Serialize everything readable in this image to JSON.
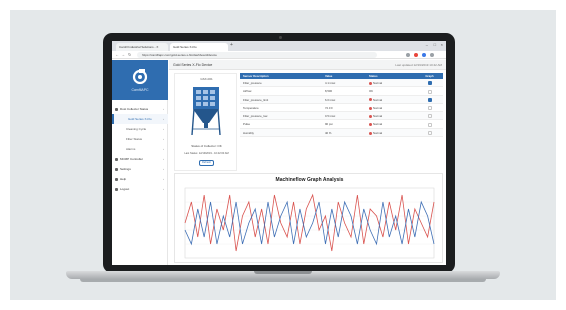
{
  "browser": {
    "tabs": [
      {
        "title": "Camfil Industrial Solutions - X"
      },
      {
        "title": "Gold Series X-Flo"
      }
    ],
    "url": "https://camfilapc.com/gold-series-x-flo/dashboard/device"
  },
  "sidebar": {
    "brand": "CamfilAPC",
    "items": [
      {
        "label": "Dust Collector Status",
        "kind": "group",
        "selected": false
      },
      {
        "label": "Gold Series X-Flo",
        "kind": "sub",
        "selected": true
      },
      {
        "label": "Cleaning Cycle",
        "kind": "sub",
        "selected": false
      },
      {
        "label": "Filter Status",
        "kind": "sub",
        "selected": false
      },
      {
        "label": "Alarms",
        "kind": "sub",
        "selected": false
      },
      {
        "label": "MCMP Controller",
        "kind": "group",
        "selected": false
      },
      {
        "label": "Settings",
        "kind": "group",
        "selected": false
      },
      {
        "label": "Help",
        "kind": "group",
        "selected": false
      },
      {
        "label": "Logout",
        "kind": "group",
        "selected": false
      }
    ]
  },
  "topbar": {
    "title": "Gold Series X-Flo Device",
    "right": "Last updated 12/19/2019 10:42 AM"
  },
  "device": {
    "id": "GSX-001",
    "status": "Status of Collector: OK",
    "last_update": "Last Status: 12/19/2019 - 10:42:00 AM",
    "refresh_label": "Refresh"
  },
  "table": {
    "headers": [
      "Sensor Description",
      "Value",
      "Status",
      "Graph"
    ],
    "rows": [
      {
        "description": "Filter_pressure",
        "value": "4.1 inwc",
        "status": "Normal",
        "status_color": "#d9534f",
        "graph": true
      },
      {
        "description": "Airflow",
        "value": "8,500",
        "status": "OK",
        "status_color": "",
        "graph": false
      },
      {
        "description": "Filter_pressure_limit",
        "value": "6.0 inwc",
        "status": "Normal",
        "status_color": "#d9534f",
        "graph": true
      },
      {
        "description": "Temperature",
        "value": "72.0 F",
        "status": "Normal",
        "status_color": "#d9534f",
        "graph": false
      },
      {
        "description": "Filter_pressure_low",
        "value": "0.5 inwc",
        "status": "Normal",
        "status_color": "#d9534f",
        "graph": false
      },
      {
        "description": "Pulse",
        "value": "90 psi",
        "status": "Normal",
        "status_color": "#d9534f",
        "graph": false
      },
      {
        "description": "Humidity",
        "value": "40 %",
        "status": "Normal",
        "status_color": "#d9534f",
        "graph": false
      }
    ]
  },
  "chart_data": {
    "type": "line",
    "title": "Machineflow Graph Analysis",
    "xlabel": "",
    "ylabel": "",
    "ylim": [
      0,
      10
    ],
    "grid": true,
    "x": [
      1,
      2,
      3,
      4,
      5,
      6,
      7,
      8,
      9,
      10,
      11,
      12,
      13,
      14,
      15,
      16,
      17,
      18,
      19,
      20,
      21,
      22,
      23,
      24,
      25,
      26,
      27,
      28,
      29,
      30,
      31,
      32,
      33,
      34,
      35,
      36,
      37,
      38,
      39,
      40
    ],
    "series": [
      {
        "color": "#d9534f",
        "values": [
          5,
          8,
          3,
          9,
          2,
          7,
          4,
          9,
          1,
          6,
          8,
          3,
          7,
          2,
          9,
          5,
          3,
          8,
          2,
          7,
          9,
          4,
          6,
          1,
          8,
          5,
          3,
          9,
          2,
          7,
          6,
          3,
          8,
          4,
          9,
          2,
          7,
          5,
          3,
          8
        ]
      },
      {
        "color": "#3f6fb5",
        "values": [
          4,
          2,
          7,
          3,
          8,
          2,
          6,
          3,
          8,
          2,
          5,
          7,
          2,
          8,
          3,
          6,
          8,
          2,
          7,
          3,
          5,
          8,
          2,
          7,
          3,
          8,
          6,
          2,
          7,
          4,
          2,
          8,
          3,
          6,
          2,
          7,
          3,
          8,
          6,
          2
        ]
      }
    ]
  }
}
